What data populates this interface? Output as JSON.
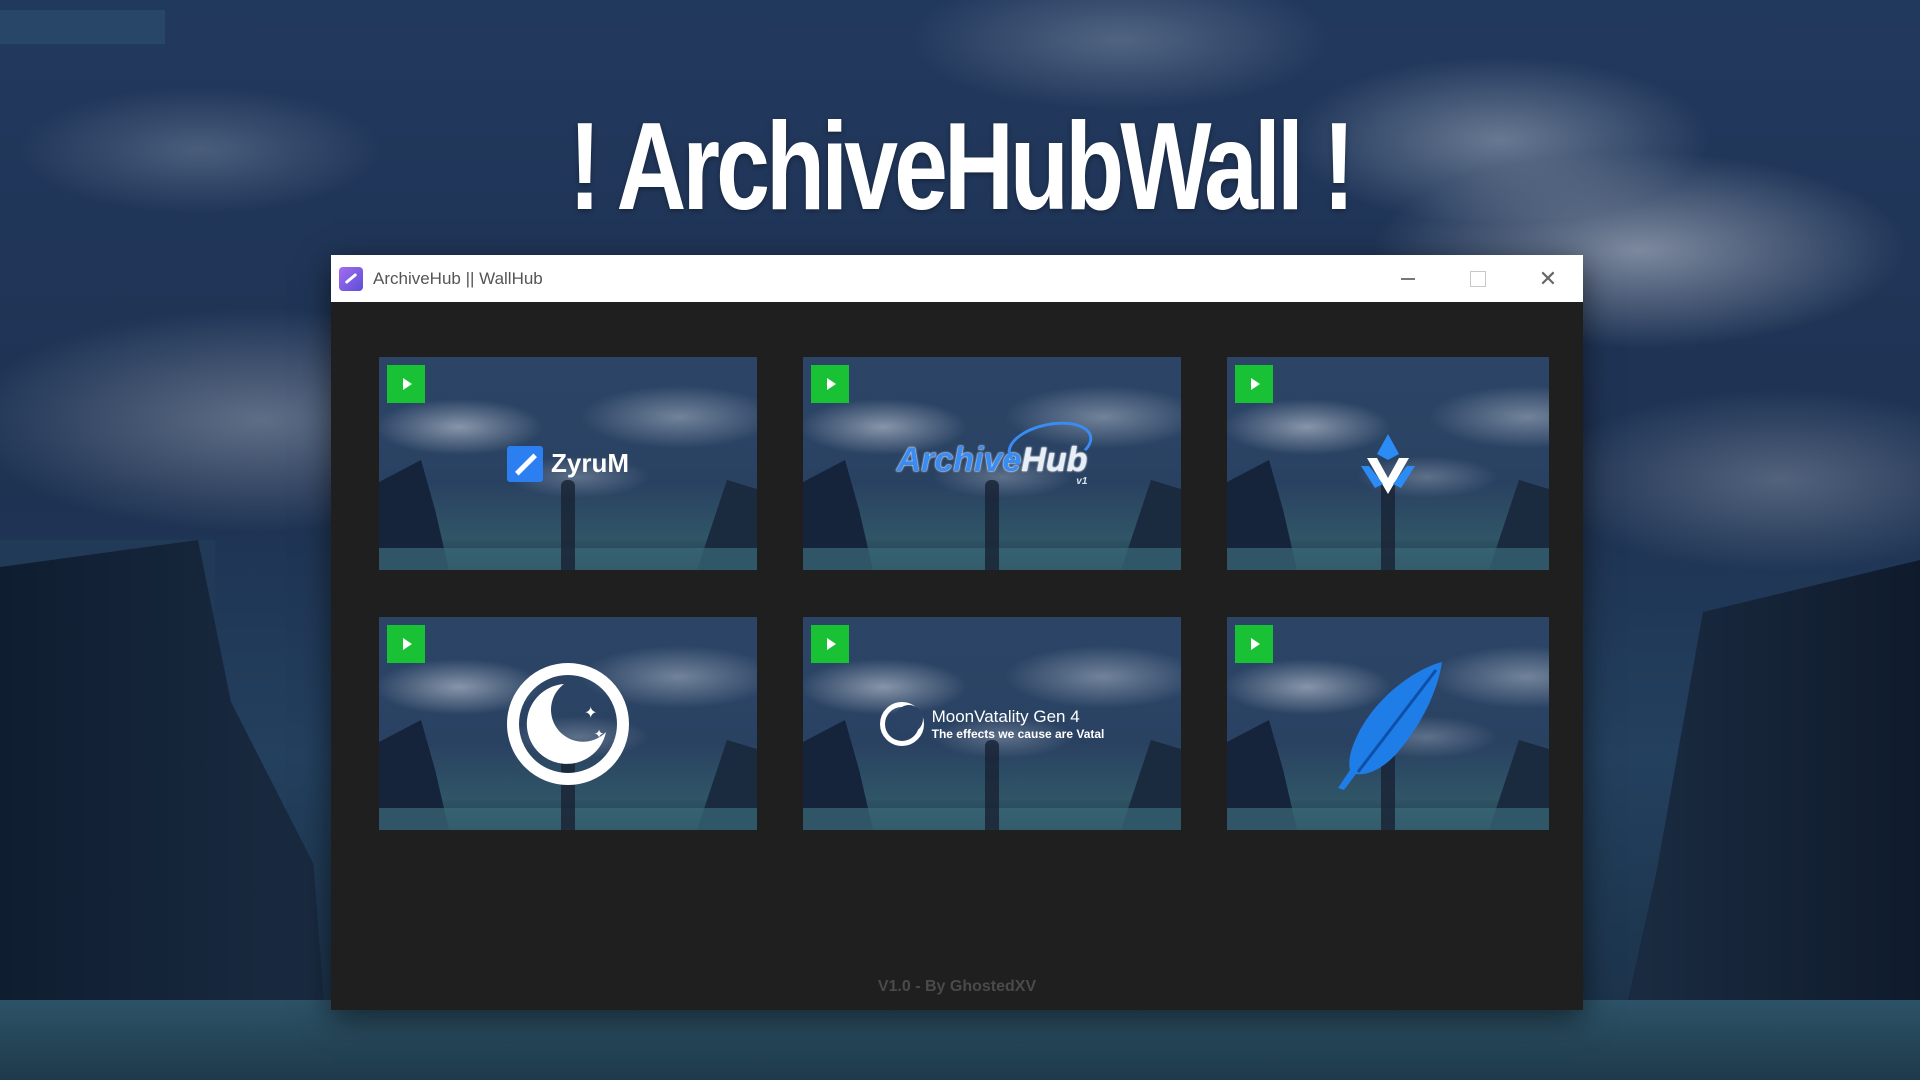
{
  "banner": {
    "title": "! ArchiveHubWall !"
  },
  "window": {
    "title": "ArchiveHub || WallHub",
    "controls": {
      "minimize": "—",
      "maximize": "",
      "close": "✕"
    }
  },
  "tiles": [
    {
      "name": "ZyruM",
      "logo_text": "ZyruM"
    },
    {
      "name": "ArchiveHub",
      "logo_text_a": "Archive",
      "logo_text_b": "Hub",
      "logo_sub": "v1"
    },
    {
      "name": "Diamond logo",
      "logo_text": ""
    },
    {
      "name": "Moon logo",
      "logo_text": ""
    },
    {
      "name": "MoonVatality",
      "logo_text": "MoonVatality Gen 4",
      "logo_sub": "The effects we cause are Vatal"
    },
    {
      "name": "Feather logo",
      "logo_text": ""
    }
  ],
  "footer": {
    "version": "V1.0 - By GhostedXV"
  },
  "colors": {
    "play": "#18c234",
    "accent_blue": "#2b7ff0",
    "window_bg": "#1f1f1f"
  }
}
